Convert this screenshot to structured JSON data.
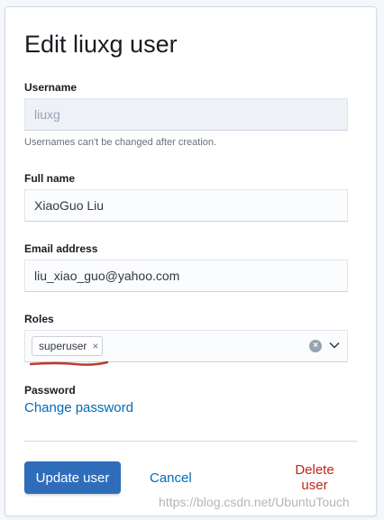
{
  "form": {
    "title": "Edit liuxg user",
    "username": {
      "label": "Username",
      "value": "liuxg",
      "help": "Usernames can't be changed after creation."
    },
    "full_name": {
      "label": "Full name",
      "value": "XiaoGuo Liu"
    },
    "email": {
      "label": "Email address",
      "value": "liu_xiao_guo@yahoo.com"
    },
    "roles": {
      "label": "Roles",
      "selected": [
        "superuser"
      ],
      "remove_glyph": "×",
      "clear_glyph": "×"
    },
    "password": {
      "label": "Password",
      "link": "Change password"
    }
  },
  "actions": {
    "update_label": "Update user",
    "cancel_label": "Cancel",
    "delete_label": "Delete user"
  },
  "watermark": "https://blog.csdn.net/UbuntuTouch",
  "colors": {
    "primary": "#2f6dbb",
    "link": "#006bb8",
    "danger": "#bd271e",
    "annotation": "#c0392b"
  }
}
